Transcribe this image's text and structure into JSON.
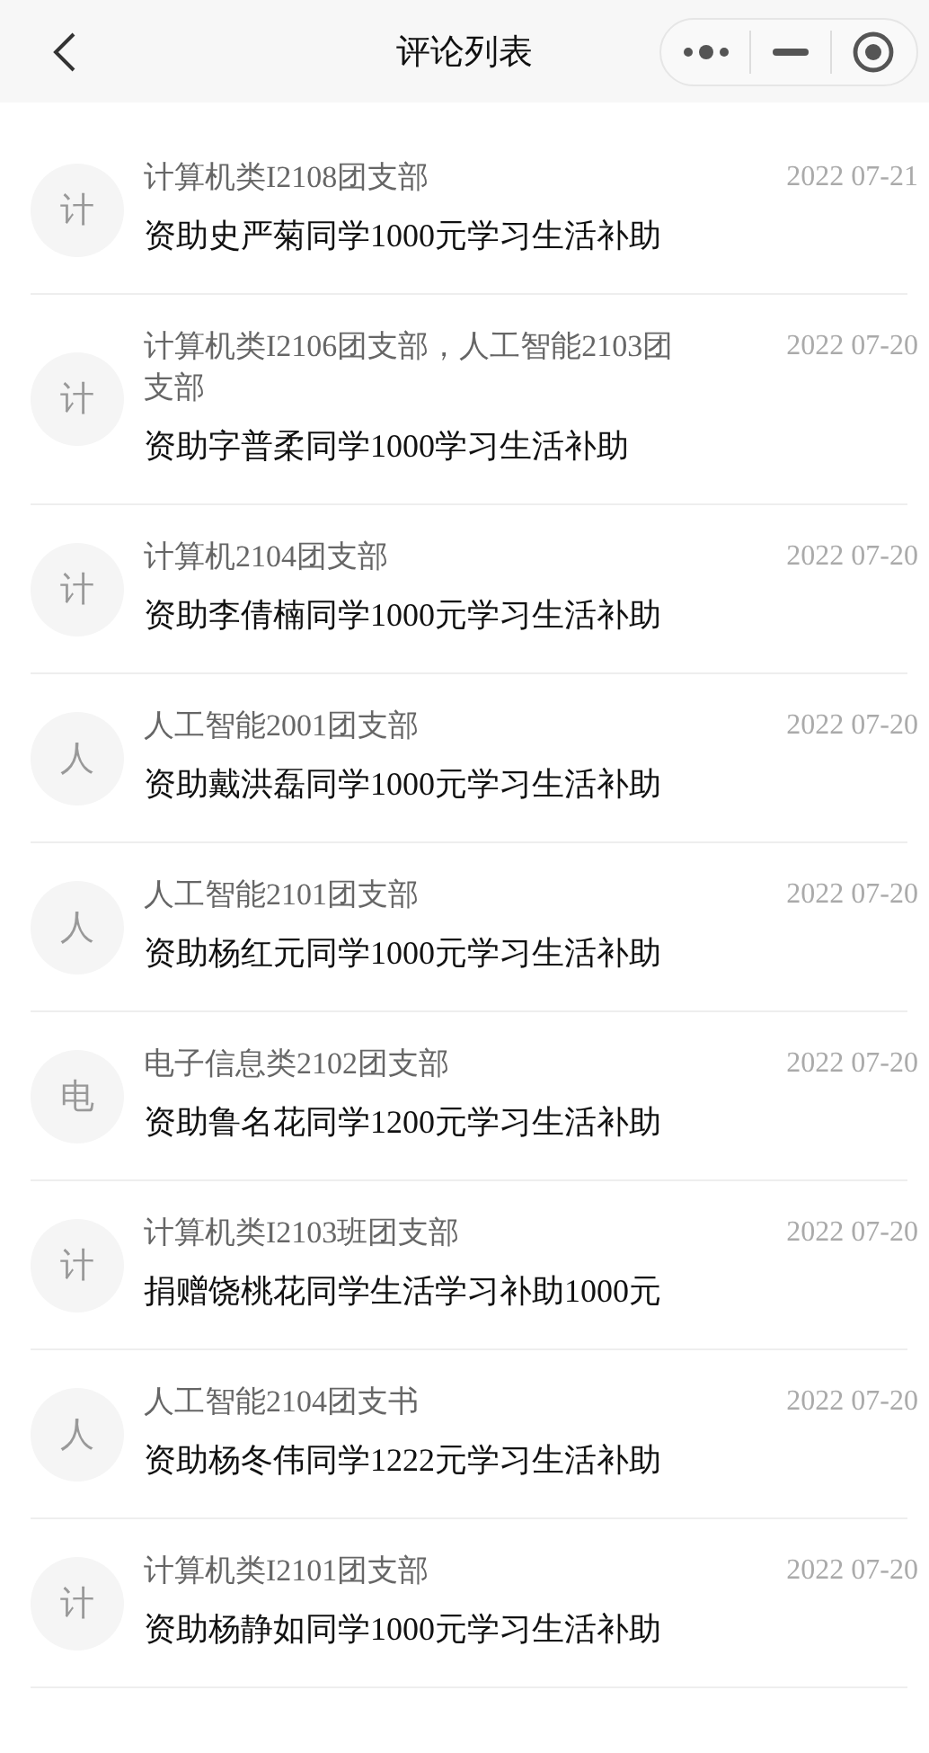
{
  "header": {
    "title": "评论列表"
  },
  "comments": [
    {
      "avatar": "计",
      "author": "计算机类I2108团支部",
      "date": "2022 07-21",
      "text": "资助史严菊同学1000元学习生活补助"
    },
    {
      "avatar": "计",
      "author": "计算机类I2106团支部，人工智能2103团支部",
      "date": "2022 07-20",
      "text": "资助字普柔同学1000学习生活补助"
    },
    {
      "avatar": "计",
      "author": "计算机2104团支部",
      "date": "2022 07-20",
      "text": "资助李倩楠同学1000元学习生活补助"
    },
    {
      "avatar": "人",
      "author": "人工智能2001团支部",
      "date": "2022 07-20",
      "text": "资助戴洪磊同学1000元学习生活补助"
    },
    {
      "avatar": "人",
      "author": "人工智能2101团支部",
      "date": "2022 07-20",
      "text": "资助杨红元同学1000元学习生活补助"
    },
    {
      "avatar": "电",
      "author": "电子信息类2102团支部",
      "date": "2022 07-20",
      "text": "资助鲁名花同学1200元学习生活补助"
    },
    {
      "avatar": "计",
      "author": "计算机类I2103班团支部",
      "date": "2022 07-20",
      "text": "捐赠饶桃花同学生活学习补助1000元"
    },
    {
      "avatar": "人",
      "author": "人工智能2104团支书",
      "date": "2022 07-20",
      "text": "资助杨冬伟同学1222元学习生活补助"
    },
    {
      "avatar": "计",
      "author": "计算机类I2101团支部",
      "date": "2022 07-20",
      "text": "资助杨静如同学1000元学习生活补助"
    }
  ]
}
